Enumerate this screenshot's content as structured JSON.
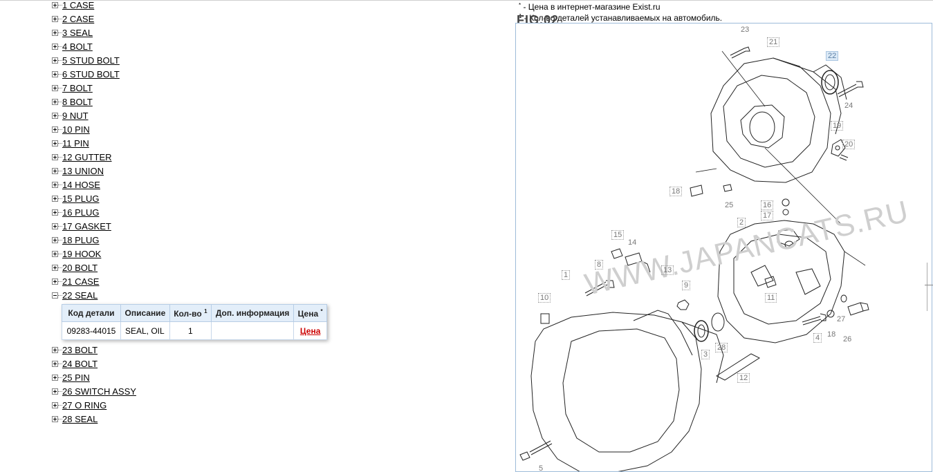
{
  "parts_before": [
    {
      "label": "1 CASE"
    },
    {
      "label": "2 CASE"
    },
    {
      "label": "3 SEAL"
    },
    {
      "label": "4 BOLT"
    },
    {
      "label": "5 STUD BOLT"
    },
    {
      "label": "6 STUD BOLT"
    },
    {
      "label": "7 BOLT"
    },
    {
      "label": "8 BOLT"
    },
    {
      "label": "9 NUT"
    },
    {
      "label": "10 PIN"
    },
    {
      "label": "11 PIN"
    },
    {
      "label": "12 GUTTER"
    },
    {
      "label": "13 UNION"
    },
    {
      "label": "14 HOSE"
    },
    {
      "label": "15 PLUG"
    },
    {
      "label": "16 PLUG"
    },
    {
      "label": "17 GASKET"
    },
    {
      "label": "18 PLUG"
    },
    {
      "label": "19 HOOK"
    },
    {
      "label": "20 BOLT"
    },
    {
      "label": "21 CASE"
    }
  ],
  "expanded_part": {
    "label": "22 SEAL",
    "headers": {
      "code": "Код детали",
      "desc": "Описание",
      "qty": "Кол-во",
      "qty_sup": "1",
      "info": "Доп. информация",
      "price": "Цена",
      "price_sup": "*"
    },
    "row": {
      "code": "09283-44015",
      "desc": "SEAL, OIL",
      "qty": "1",
      "info": "",
      "price": "Цена"
    }
  },
  "parts_after": [
    {
      "label": "23 BOLT"
    },
    {
      "label": "24 BOLT"
    },
    {
      "label": "25 PIN"
    },
    {
      "label": "26 SWITCH ASSY"
    },
    {
      "label": "27 O RING"
    },
    {
      "label": "28 SEAL"
    }
  ],
  "notes": {
    "price_sym": "*",
    "price_note": " - Цена в интернет-магазине Exist.ru",
    "qty_sym": "1",
    "qty_note": " - Кол-во деталей устанавливаемых на автомобиль."
  },
  "figure": {
    "title": "FIG.02",
    "watermark": "WWW.JAPANCATS.RU",
    "callouts": [
      "23",
      "21",
      "22",
      "24",
      "19",
      "20",
      "18",
      "25",
      "16",
      "17",
      "2",
      "15",
      "14",
      "13",
      "8",
      "9",
      "10",
      "1",
      "11",
      "27",
      "4",
      "18",
      "26",
      "3",
      "28",
      "12",
      "5"
    ]
  }
}
